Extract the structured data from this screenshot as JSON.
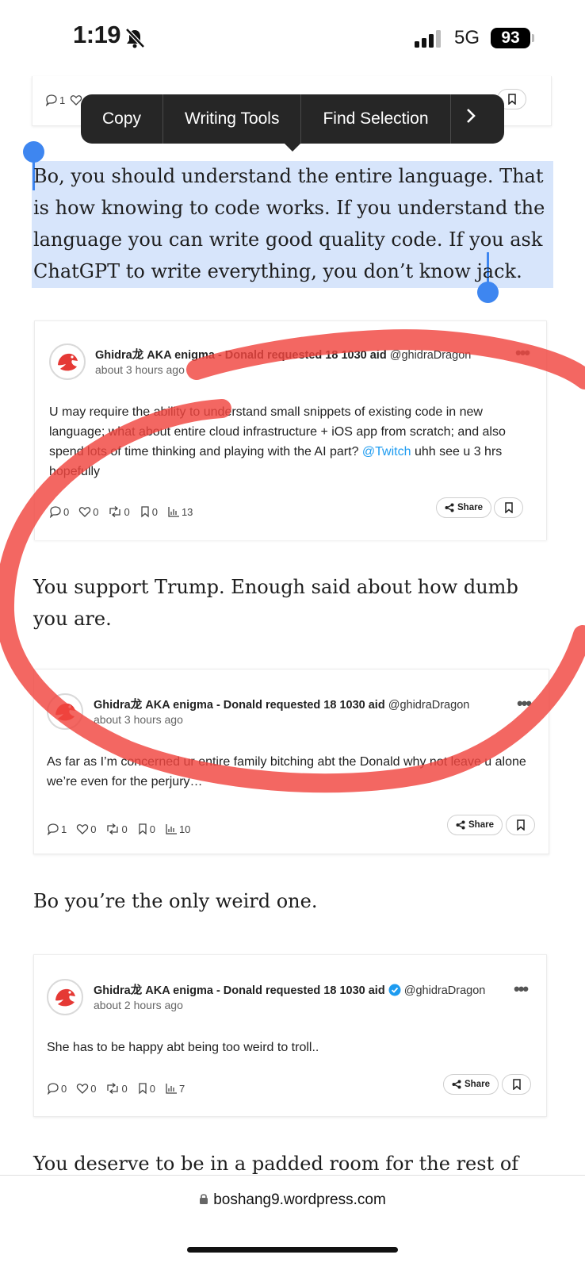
{
  "status_bar": {
    "time": "1:19",
    "network": "5G",
    "battery": "93"
  },
  "selection_menu": {
    "items": [
      "Copy",
      "Writing Tools",
      "Find Selection"
    ],
    "more": ">"
  },
  "top_card": {
    "replies": "1"
  },
  "paragraphs": [
    "Bo, you should understand the entire language. That is how knowing to code works. If you understand the language you can write good quality code. If you ask ChatGPT to write everything, you don’t know jack.",
    "You support Trump. Enough said about how dumb you are.",
    "Bo you’re the only weird one.",
    "You deserve to be in a padded room for the rest of your life."
  ],
  "tweets": [
    {
      "name": "Ghidra龙 AKA enigma - Donald requested 18 1030 aid",
      "handle": "@ghidraDragon",
      "time": "about 3 hours ago",
      "body": "U may require the ability to understand small snippets of existing code in new language; what about entire cloud infrastructure + iOS app from scratch; and also spend lots of time thinking and playing with the AI part?",
      "mention": "@Twitch",
      "body_end": "uhh see u 3 hrs hopefully",
      "replies": "0",
      "likes": "0",
      "retweets": "0",
      "bookmarks": "0",
      "views": "13",
      "share": "Share"
    },
    {
      "name": "Ghidra龙 AKA enigma - Donald requested 18 1030 aid",
      "handle": "@ghidraDragon",
      "time": "about 3 hours ago",
      "body": "As far as I’m concerned ur entire family bitching abt the Donald why not leave u alone we’re even for the perjury…",
      "replies": "1",
      "likes": "0",
      "retweets": "0",
      "bookmarks": "0",
      "views": "10",
      "share": "Share"
    },
    {
      "name": "Ghidra龙 AKA enigma - Donald requested 18 1030 aid",
      "handle": "@ghidraDragon",
      "time": "about 2 hours ago",
      "body": "She has to be happy abt being too weird to troll..",
      "replies": "0",
      "likes": "0",
      "retweets": "0",
      "bookmarks": "0",
      "views": "7",
      "share": "Share"
    }
  ],
  "url_bar": {
    "domain": "boshang9.wordpress.com"
  },
  "colors": {
    "selection": "#d7e5fb",
    "handle": "#3e86f0",
    "scribble": "#f0453f",
    "mention": "#1d9bf0"
  }
}
